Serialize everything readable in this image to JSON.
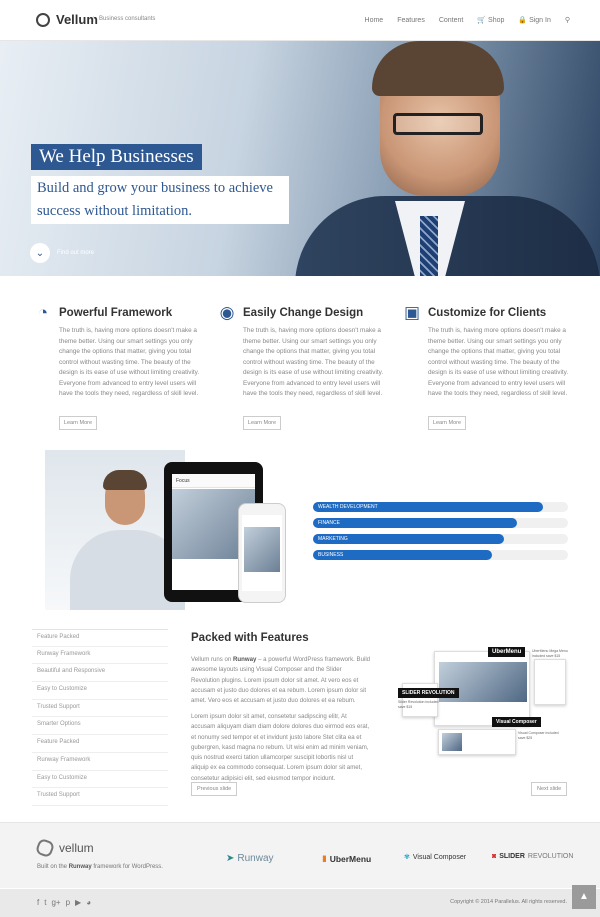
{
  "header": {
    "logo_text": "Vellum",
    "tagline": "Business consultants",
    "nav": {
      "home": "Home",
      "features": "Features",
      "content": "Content",
      "shop": "Shop",
      "signin": "Sign In"
    }
  },
  "hero": {
    "title": "We Help Businesses",
    "subtitle": "Build and grow your business to achieve success without limitation.",
    "cta": "Find out more"
  },
  "features": [
    {
      "title": "Powerful Framework",
      "body": "The truth is, having more options doesn't make a theme better. Using our smart settings you only change the options that matter, giving you total control without wasting time. The beauty of the design is its ease of use without limiting creativity. Everyone from advanced to entry level users will have the tools they need, regardless of skill level.",
      "button": "Learn More",
      "icon": "dashboard-icon"
    },
    {
      "title": "Easily Change Design",
      "body": "The truth is, having more options doesn't make a theme better. Using our smart settings you only change the options that matter, giving you total control without wasting time. The beauty of the design is its ease of use without limiting creativity. Everyone from advanced to entry level users will have the tools they need, regardless of skill level.",
      "button": "Learn More",
      "icon": "eye-icon"
    },
    {
      "title": "Customize for Clients",
      "body": "The truth is, having more options doesn't make a theme better. Using our smart settings you only change the options that matter, giving you total control without wasting time. The beauty of the design is its ease of use without limiting creativity. Everyone from advanced to entry level users will have the tools they need, regardless of skill level.",
      "button": "Learn More",
      "icon": "monitor-icon"
    }
  ],
  "showcase": {
    "tablet_brand": "Focus"
  },
  "skills": [
    {
      "label": "WEALTH DEVELOPMENT",
      "percent": 90
    },
    {
      "label": "FINANCE",
      "percent": 80
    },
    {
      "label": "MARKETING",
      "percent": 75
    },
    {
      "label": "BUSINESS",
      "percent": 70
    }
  ],
  "sidebar": {
    "items": [
      "Feature Packed",
      "Runway Framework",
      "Beautiful and Responsive",
      "Easy to Customize",
      "Trusted Support",
      "Smarter Options",
      "Feature Packed",
      "Runway Framework",
      "Easy to Customize",
      "Trusted Support"
    ]
  },
  "packed": {
    "title": "Packed with Features",
    "p1_a": "Vellum runs on ",
    "p1_b": "Runway",
    "p1_c": " – a powerful WordPress framework. Build awesome layouts using Visual Composer and the Slider Revolution plugins. Lorem ipsum dolor sit amet. At vero eos et accusam et justo duo dolores et ea rebum. Lorem ipsum dolor sit amet. Vero eos et accusam et justo duo dolores et ea rebum.",
    "p2": "Lorem ipsum dolor sit amet, consetetur sadipscing elitr, At accusam aliquyam diam diam dolore dolores duo eirmod eos erat, et nonumy sed tempor et et invidunt justo labore Stet clita ea et gubergren, kasd magna no rebum. Ut wisi enim ad minim veniam, quis nostrud exerci tation ullamcorper suscipit lobortis nisl ut aliquip ex ea commodo consequat. Lorem ipsum dolor sit amet, consetetur adipisici elit, sed eiusmod tempor incidunt.",
    "prev": "Previous slide",
    "next": "Next slide"
  },
  "collage": {
    "ubermenu": "UberMenu",
    "ubermenu_note": "UberMenu Mega Menu included save $15",
    "slider": "SLIDER REVOLUTION",
    "slider_note": "Slider Revolution included save $15",
    "vc": "Visual Composer",
    "vc_note": "Visual Composer included save $25"
  },
  "footer": {
    "logo_text": "vellum",
    "built_a": "Built on the ",
    "built_b": "Runway",
    "built_c": " framework for WordPress.",
    "brands": {
      "runway": "Runway",
      "ubermenu": "UberMenu",
      "vc": "Visual Composer",
      "slider_a": "SLIDER",
      "slider_b": " REVOLUTION"
    },
    "copyright": "Copyright © 2014 Parallelus. All rights reserved."
  },
  "colors": {
    "accent": "#2e5891",
    "progress": "#1e6bc4"
  }
}
